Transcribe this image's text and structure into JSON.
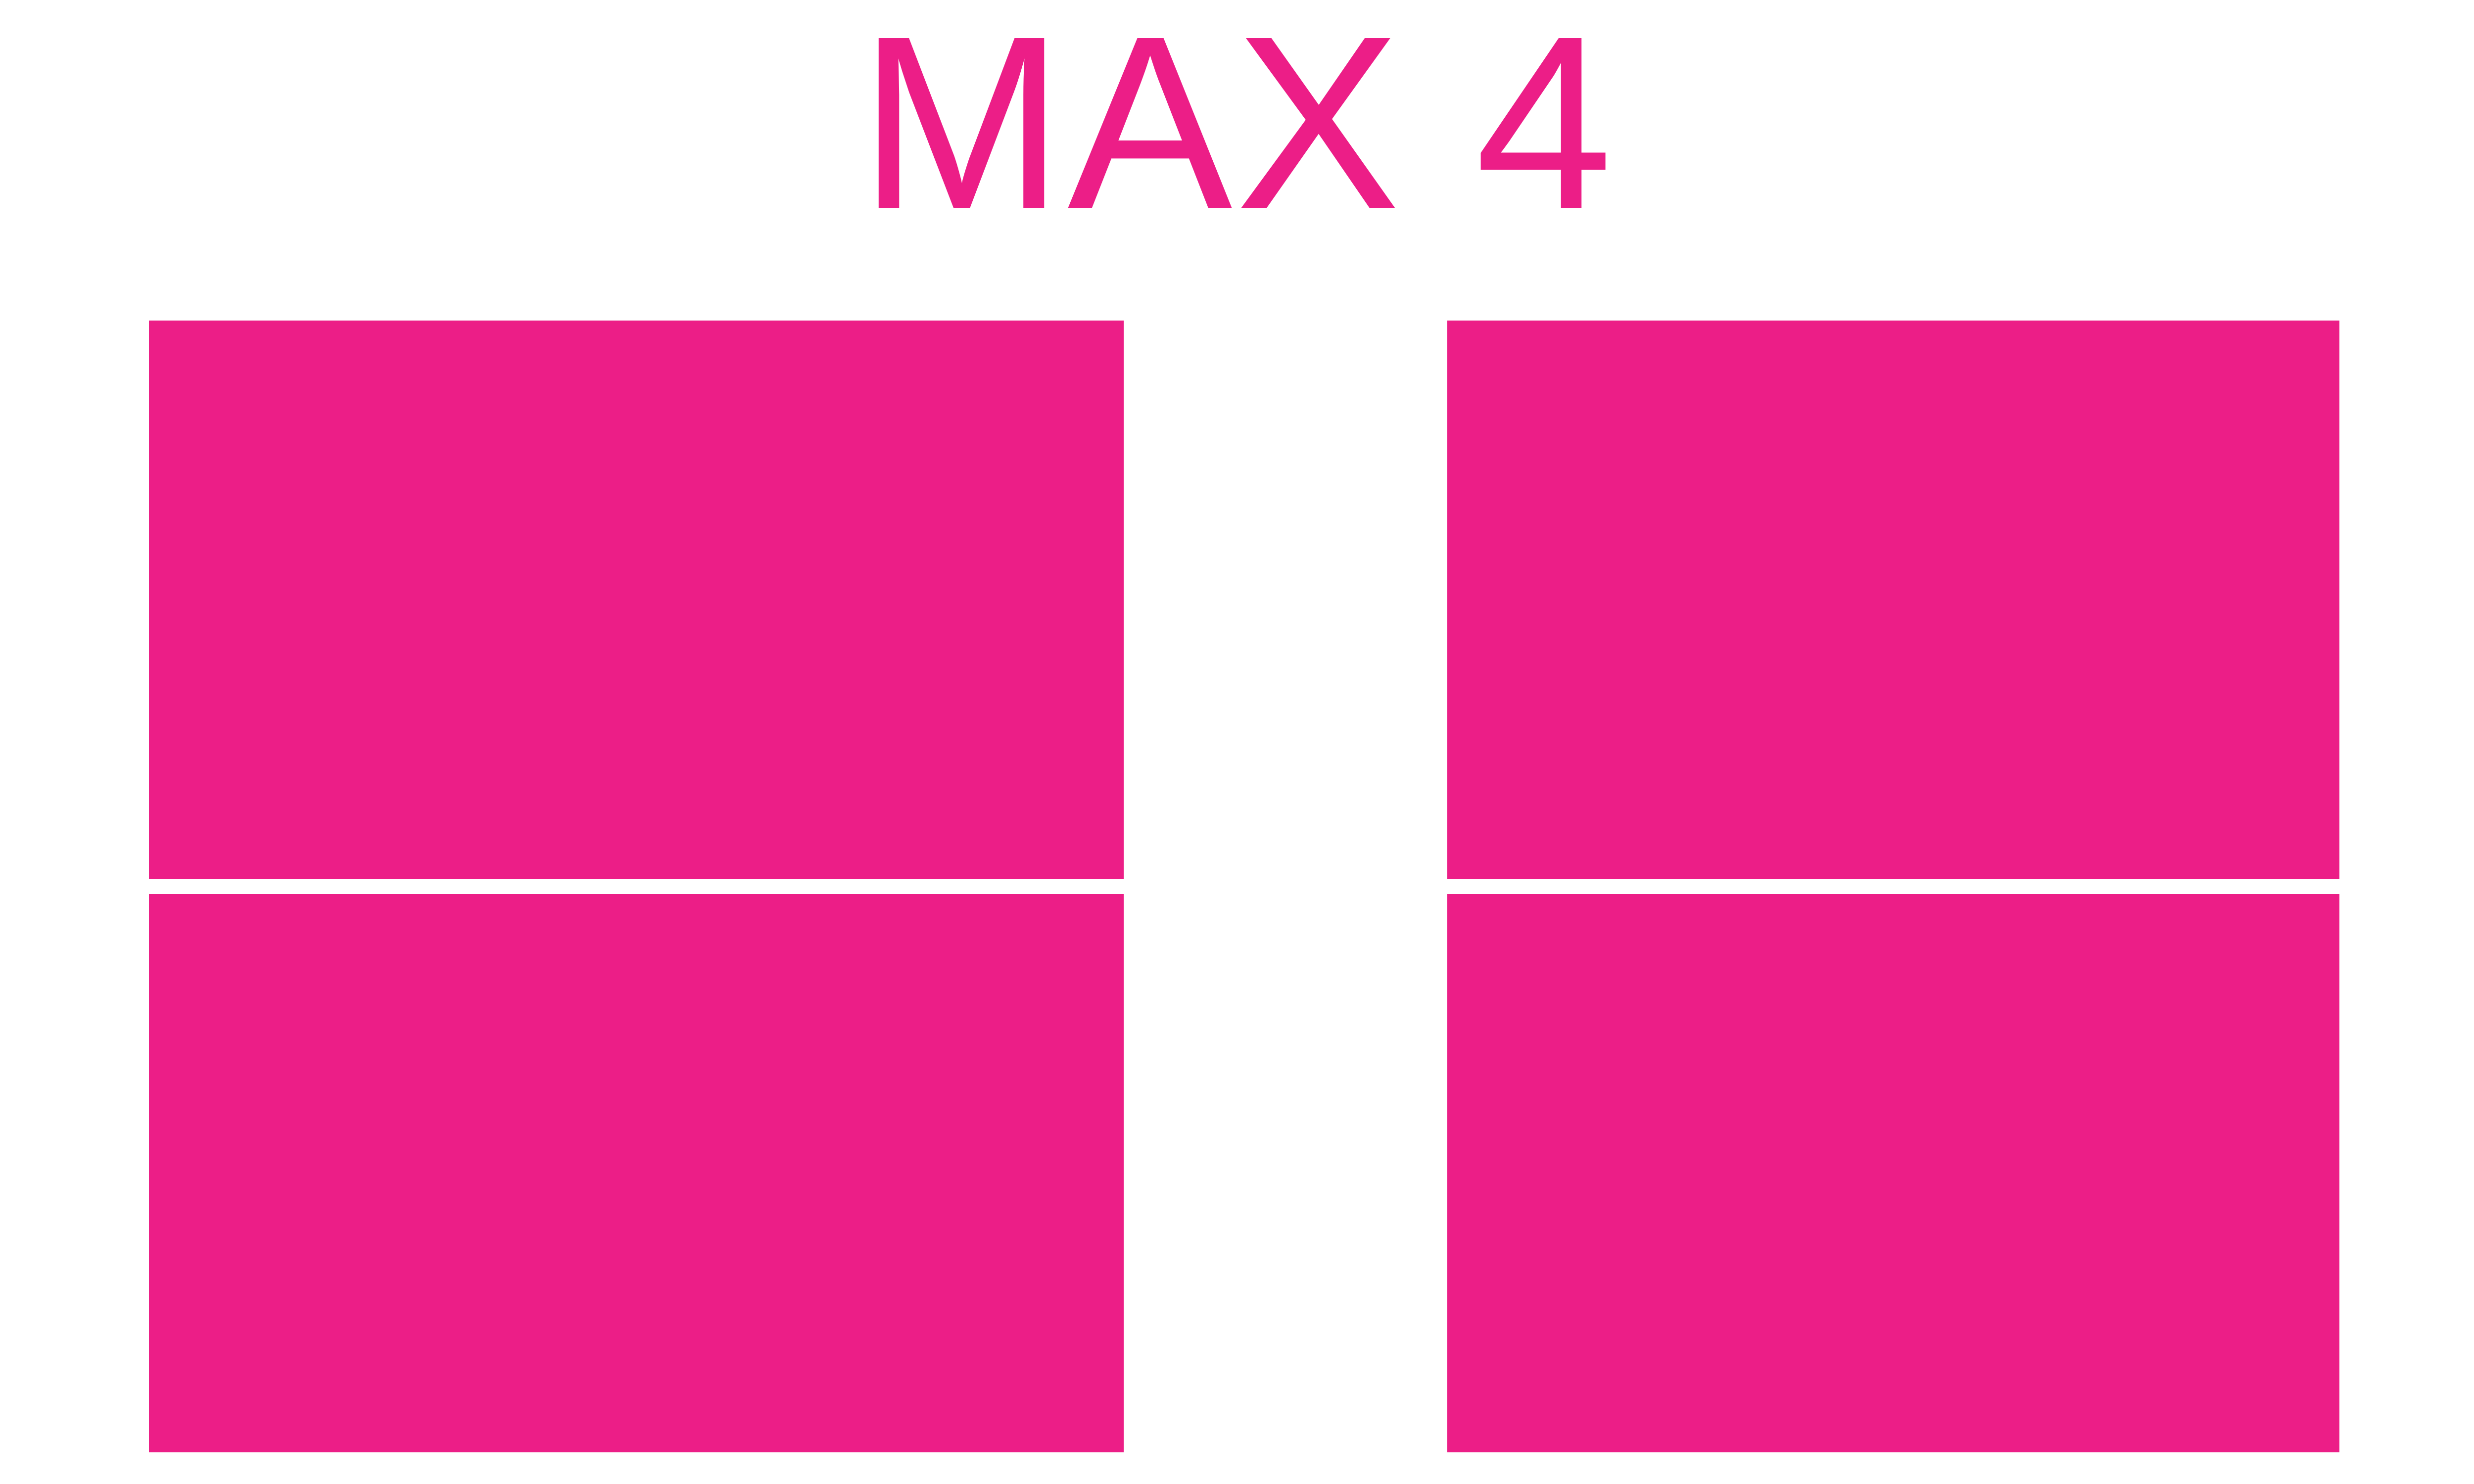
{
  "title": "MAX 4",
  "colors": {
    "accent": "#EC1E87",
    "background": "#FFFFFF"
  },
  "boxes": [
    {
      "name": "top-left"
    },
    {
      "name": "top-right"
    },
    {
      "name": "bottom-left"
    },
    {
      "name": "bottom-right"
    }
  ]
}
